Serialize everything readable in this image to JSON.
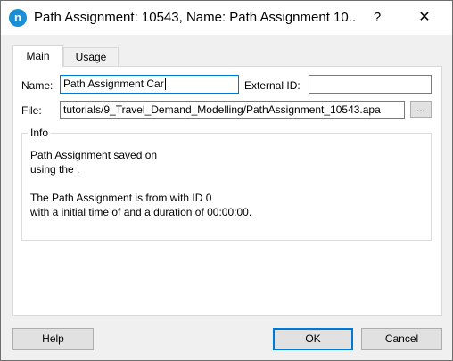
{
  "window": {
    "app_icon_letter": "n",
    "title": "Path Assignment: 10543, Name: Path Assignment 10...",
    "help_glyph": "?",
    "close_glyph": "✕"
  },
  "tabs": [
    {
      "label": "Main",
      "selected": true
    },
    {
      "label": "Usage",
      "selected": false
    }
  ],
  "form": {
    "name_label": "Name:",
    "name_value": "Path Assignment Car",
    "external_id_label": "External ID:",
    "external_id_value": "",
    "file_label": "File:",
    "file_value": "tutorials/9_Travel_Demand_Modelling/PathAssignment_10543.apa",
    "browse_label": "..."
  },
  "info": {
    "title": "Info",
    "lines": [
      "Path Assignment saved on",
      "using the  .",
      "",
      "The Path Assignment is from  with ID 0",
      "with a initial time of  and a duration of 00:00:00."
    ]
  },
  "buttons": {
    "help": "Help",
    "ok": "OK",
    "cancel": "Cancel"
  },
  "colors": {
    "accent": "#0078d7",
    "app_icon": "#1a8fd6"
  }
}
